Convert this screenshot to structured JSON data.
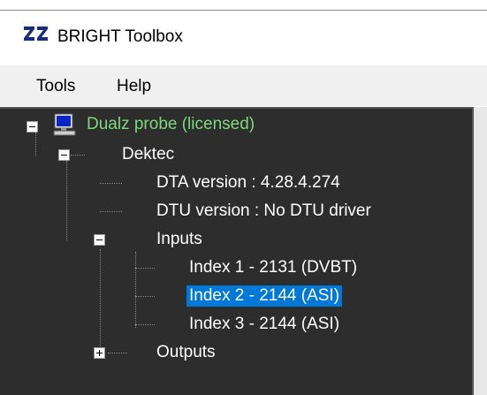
{
  "window": {
    "title": "BRIGHT Toolbox",
    "app_icon": "zz-logo-icon"
  },
  "menu": {
    "items": [
      "Tools",
      "Help"
    ]
  },
  "tree": {
    "root": {
      "label": "Dualz probe (licensed)",
      "icon": "computer-icon",
      "expanded": true
    },
    "dektec": {
      "label": "Dektec",
      "expanded": true
    },
    "dta_version": {
      "label": "DTA version : 4.28.4.274"
    },
    "dtu_version": {
      "label": "DTU version : No DTU driver"
    },
    "inputs": {
      "label": "Inputs",
      "expanded": true,
      "items": [
        "Index 1 - 2131 (DVBT)",
        "Index 2 - 2144 (ASI)",
        "Index 3 - 2144 (ASI)"
      ],
      "selected_index": 1
    },
    "outputs": {
      "label": "Outputs",
      "expanded": false
    }
  },
  "colors": {
    "tree_bg": "#2d2d2d",
    "root_text": "#7dd87d",
    "selection": "#0078d7"
  }
}
